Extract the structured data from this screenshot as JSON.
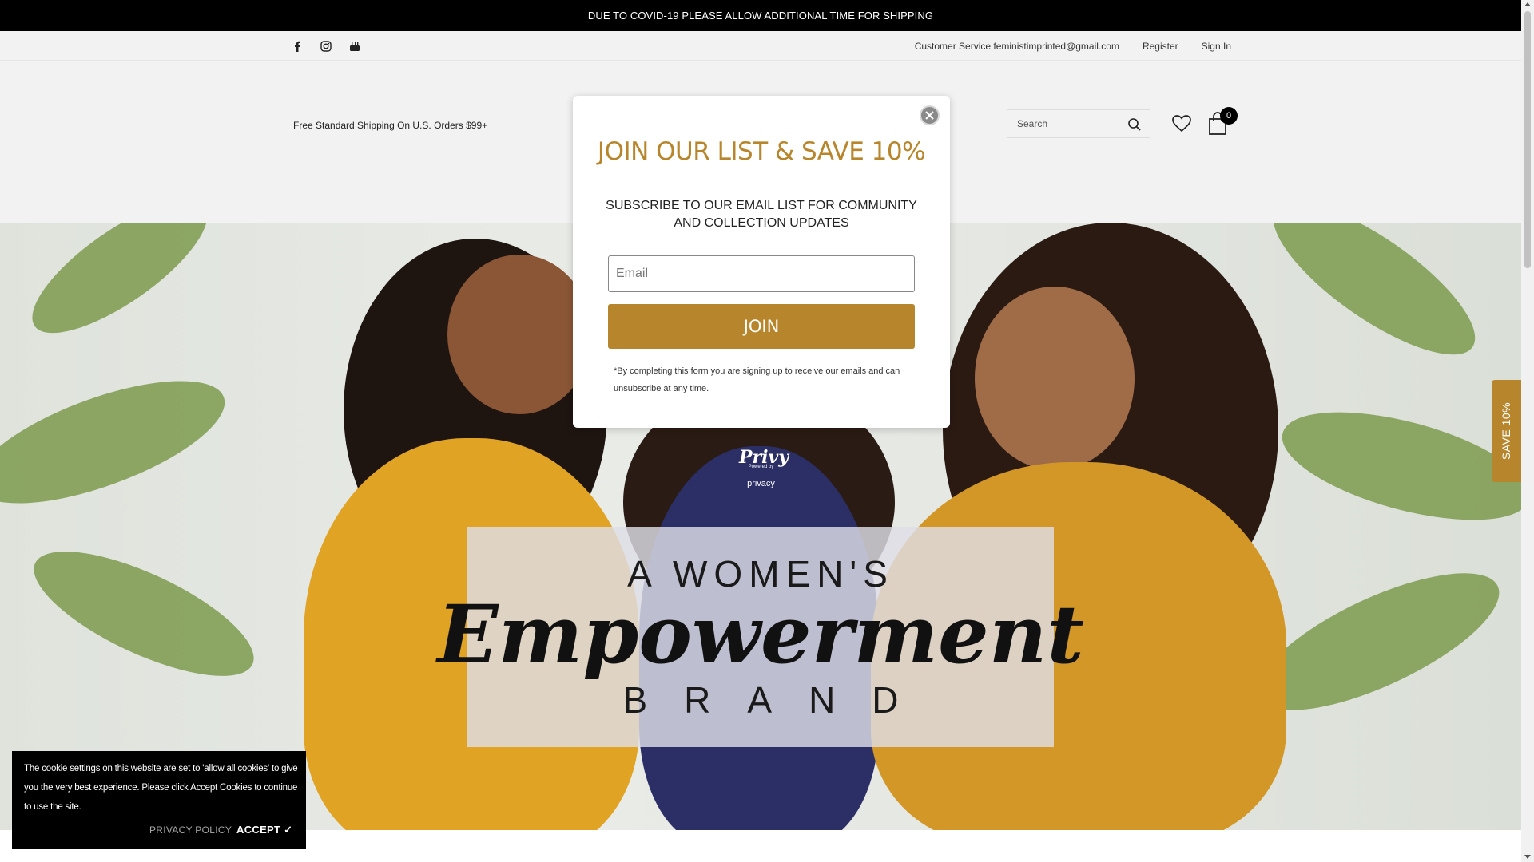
{
  "announcement": {
    "text": "DUE TO COVID-19 PLEASE ALLOW ADDITIONAL TIME FOR SHIPPING"
  },
  "social": {
    "icons": [
      "facebook-icon",
      "instagram-icon",
      "youtube-icon"
    ]
  },
  "top_links": {
    "customer_service": "Customer Service feministimprinted@gmail.com",
    "register": "Register",
    "sign_in": "Sign In"
  },
  "header": {
    "shipping_message": "Free Standard Shipping On U.S. Orders $99+",
    "search_placeholder": "Search",
    "cart_count": "0"
  },
  "hero": {
    "line1": "A WOMEN'S",
    "line2": "Empowerment",
    "line3": "BRAND"
  },
  "privy": {
    "logo": "Privy",
    "powered": "Powered by",
    "privacy": "privacy"
  },
  "side_tab": {
    "label": "SAVE 10%"
  },
  "modal": {
    "title": "JOIN OUR LIST & SAVE 10%",
    "subtitle": "SUBSCRIBE TO OUR EMAIL LIST FOR COMMUNITY AND COLLECTION UPDATES",
    "email_placeholder": "Email",
    "join_label": "JOIN",
    "disclaimer": "*By completing this form you are signing up to receive our emails and can unsubscribe at any time."
  },
  "cookie": {
    "text": "The cookie settings on this website are set to 'allow all cookies' to give you the very best experience. Please click Accept Cookies to continue to use the site.",
    "policy_label": "PRIVACY POLICY",
    "accept_label": "ACCEPT  ✓"
  },
  "colors": {
    "accent": "#b7862c",
    "dark": "#000000",
    "header_bg": "#f2f2f2"
  }
}
